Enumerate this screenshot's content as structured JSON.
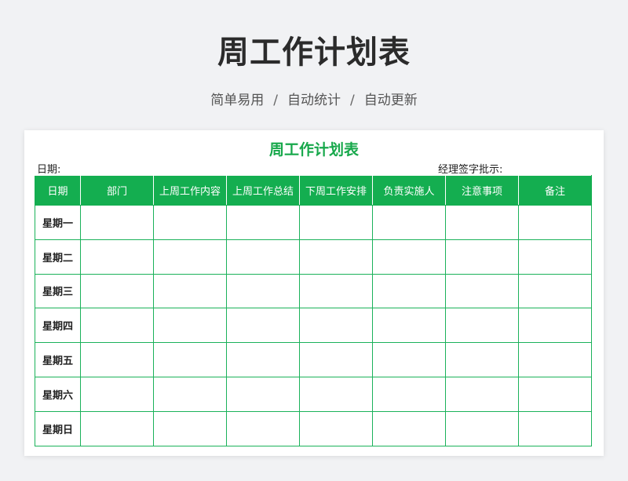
{
  "header": {
    "title": "周工作计划表",
    "subtitle_parts": [
      "简单易用",
      "自动统计",
      "自动更新"
    ],
    "separator": "/"
  },
  "sheet": {
    "title": "周工作计划表",
    "date_label": "日期:",
    "approval_label": "经理签字批示:",
    "columns": [
      "日期",
      "部门",
      "上周工作内容",
      "上周工作总结",
      "下周工作安排",
      "负责实施人",
      "注意事项",
      "备注"
    ],
    "days": [
      "星期一",
      "星期二",
      "星期三",
      "星期四",
      "星期五",
      "星期六",
      "星期日"
    ]
  },
  "colors": {
    "accent": "#14ae50",
    "title_green": "#17a84b",
    "page_bg": "#f1f2f4"
  }
}
